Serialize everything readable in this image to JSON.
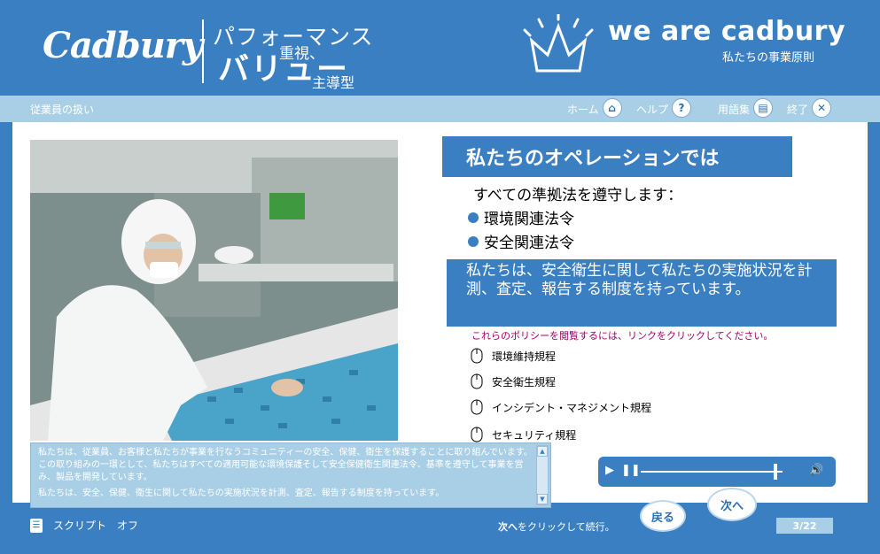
{
  "header": {
    "logo": "Cadbury",
    "tagline_line1": "パフォーマンス",
    "tagline_line2": "重視、",
    "tagline_line3": "バリュー",
    "tagline_line4": "主導型",
    "brand_title": "we are cadbury",
    "brand_subtitle": "私たちの事業原則"
  },
  "navbar": {
    "section_title": "従業員の扱い",
    "home": "ホーム",
    "help": "ヘルプ",
    "glossary": "用語集",
    "exit": "終了"
  },
  "main": {
    "operations_title": "私たちのオペレーションでは",
    "lead": "すべての準拠法を遵守します：",
    "bullets": [
      "環境関連法令",
      "安全関連法令"
    ],
    "highlight": "私たちは、安全衛生に関して私たちの実施状況を計測、査定、報告する制度を持っています。",
    "policy_prompt": "これらのポリシーを閲覧するには、リンクをクリックしてください。",
    "policies": [
      "環境維持規程",
      "安全衛生規程",
      "インシデント・マネジメント規程",
      "セキュリティ規程"
    ]
  },
  "script": {
    "paragraph1": "私たちは、従業員、お客様と私たちが事業を行なうコミュニティーの安全、保健、衛生を保護することに取り組んでいます。この取り組みの一環として、私たちはすべての適用可能な環境保護そして安全保健衛生関連法令、基準を遵守して事業を営み、製品を開発しています。",
    "paragraph2": "私たちは、安全、保健、衛生に関して私たちの実施状況を計測、査定、報告する制度を持っています。"
  },
  "footer": {
    "script_toggle": "スクリプト　オフ",
    "hint_bold": "次へ",
    "hint_rest": "をクリックして続行。",
    "back": "戻る",
    "next": "次へ",
    "page": "3/22"
  },
  "media": {
    "progress": 0.95
  }
}
